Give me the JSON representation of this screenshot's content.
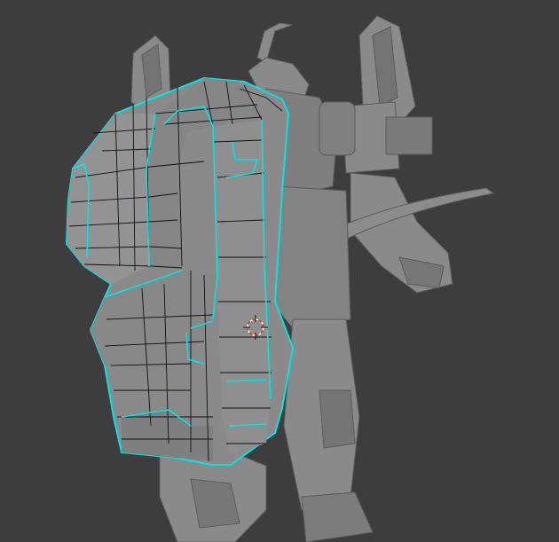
{
  "viewport": {
    "background": "#3d3d3d",
    "mesh_color": "#8a8a8a",
    "mesh_dark": "#6b6b6b",
    "mesh_light": "#a3a3a3",
    "selection_color": "#00e5e5",
    "wire_color": "#111111",
    "cursor_icon": "3d-cursor-icon",
    "cursor_color_a": "#e03030",
    "cursor_color_b": "#ffffff"
  }
}
